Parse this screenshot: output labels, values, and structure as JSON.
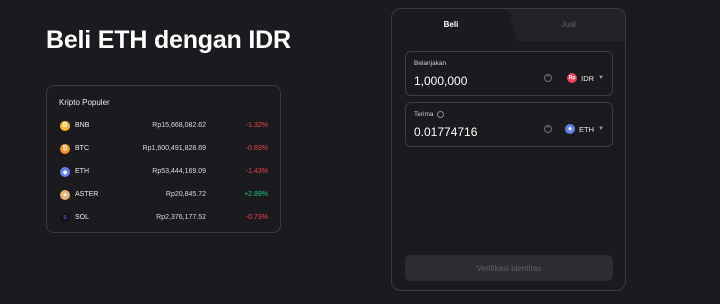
{
  "page": {
    "title": "Beli ETH dengan IDR"
  },
  "popular": {
    "heading": "Kripto Populer",
    "coins": [
      {
        "symbol": "BNB",
        "price": "Rp15,668,082.62",
        "change": "-1.32%",
        "trend": "neg",
        "icon_color": "#f3ba2f",
        "icon_glyph": "B"
      },
      {
        "symbol": "BTC",
        "price": "Rp1,600,491,828.69",
        "change": "-0.83%",
        "trend": "neg",
        "icon_color": "#f7931a",
        "icon_glyph": "₿"
      },
      {
        "symbol": "ETH",
        "price": "Rp53,444,169.09",
        "change": "-1.43%",
        "trend": "neg",
        "icon_color": "#627eea",
        "icon_glyph": "◆"
      },
      {
        "symbol": "ASTER",
        "price": "Rp20,845.72",
        "change": "+2.89%",
        "trend": "pos",
        "icon_color": "#e8b27a",
        "icon_glyph": "✦"
      },
      {
        "symbol": "SOL",
        "price": "Rp2,376,177.52",
        "change": "-0.73%",
        "trend": "neg",
        "icon_color": "#14101f",
        "icon_glyph": "≡"
      }
    ]
  },
  "trade": {
    "tabs": {
      "buy": "Beli",
      "sell": "Jual"
    },
    "spend": {
      "label": "Belanjakan",
      "value": "1,000,000",
      "currency": "IDR",
      "currency_icon": "Rp",
      "currency_color": "#e8445a"
    },
    "receive": {
      "label": "Terima",
      "value": "0.01774716",
      "currency": "ETH",
      "currency_icon": "◆",
      "currency_color": "#627eea"
    },
    "verify_label": "Verifikasi Identitas"
  },
  "colors": {
    "negative": "#f0414f",
    "positive": "#22c07a",
    "background": "#1b1b1f"
  }
}
